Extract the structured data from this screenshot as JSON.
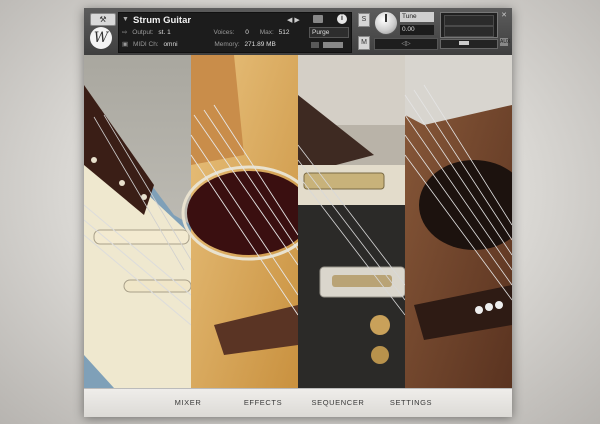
{
  "instrument": {
    "name": "Strum Guitar",
    "logo_letter": "W",
    "output_label": "Output:",
    "output_value": "st. 1",
    "midi_label": "MIDI Ch:",
    "midi_value": "omni",
    "voices_label": "Voices:",
    "voices_value": "0",
    "max_label": "Max:",
    "max_value": "512",
    "memory_label": "Memory:",
    "memory_value": "271.89 MB",
    "purge_label": "Purge",
    "solo_label": "S",
    "mute_label": "M"
  },
  "tune": {
    "label": "Tune",
    "value": "0.00"
  },
  "tabs": [
    {
      "label": "MIXER"
    },
    {
      "label": "EFFECTS"
    },
    {
      "label": "SEQUENCER"
    },
    {
      "label": "SETTINGS"
    }
  ],
  "colors": {
    "header_bg": "#3f3f3f",
    "footer_bg": "#e6e4e0",
    "tab_text": "#3a3a3a"
  }
}
